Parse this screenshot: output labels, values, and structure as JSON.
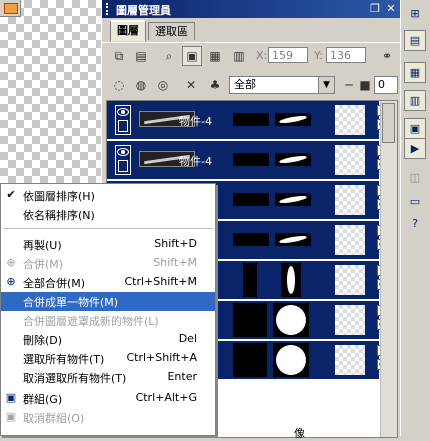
{
  "panel": {
    "title": "圖層管理員",
    "tabs": [
      "圖層",
      "選取區"
    ],
    "x_label": "X:",
    "x_value": "159",
    "y_label": "Y:",
    "y_value": "136",
    "filter_value": "全部",
    "num_value": "0"
  },
  "layers": [
    {
      "name": "物件-4"
    },
    {
      "name": "物件-4"
    }
  ],
  "bottom_text": "像",
  "context_menu": {
    "items": [
      {
        "label": "依圖層排序(H)",
        "shortcut": "",
        "checked": true,
        "disabled": false
      },
      {
        "label": "依名稱排序(N)",
        "shortcut": "",
        "checked": false,
        "disabled": false
      },
      {
        "label": "再製(U)",
        "shortcut": "Shift+D",
        "disabled": false
      },
      {
        "label": "合併(M)",
        "shortcut": "Shift+M",
        "disabled": true
      },
      {
        "label": "全部合併(M)",
        "shortcut": "Ctrl+Shift+M",
        "disabled": false
      },
      {
        "label": "合併成單一物件(M)",
        "shortcut": "",
        "disabled": true,
        "highlighted": true
      },
      {
        "label": "合併圖層遮罩成新的物件(L)",
        "shortcut": "",
        "disabled": true
      },
      {
        "label": "刪除(D)",
        "shortcut": "Del",
        "disabled": false
      },
      {
        "label": "選取所有物件(T)",
        "shortcut": "Ctrl+Shift+A",
        "disabled": false
      },
      {
        "label": "取消選取所有物件(T)",
        "shortcut": "Enter",
        "disabled": false
      },
      {
        "label": "群組(G)",
        "shortcut": "Ctrl+Alt+G",
        "disabled": false
      },
      {
        "label": "取消群組(O)",
        "shortcut": "",
        "disabled": true
      }
    ]
  },
  "colors": {
    "title_bar": "#0a246a",
    "layer_selected": "#0a246a",
    "menu_highlight": "#316ac5"
  }
}
